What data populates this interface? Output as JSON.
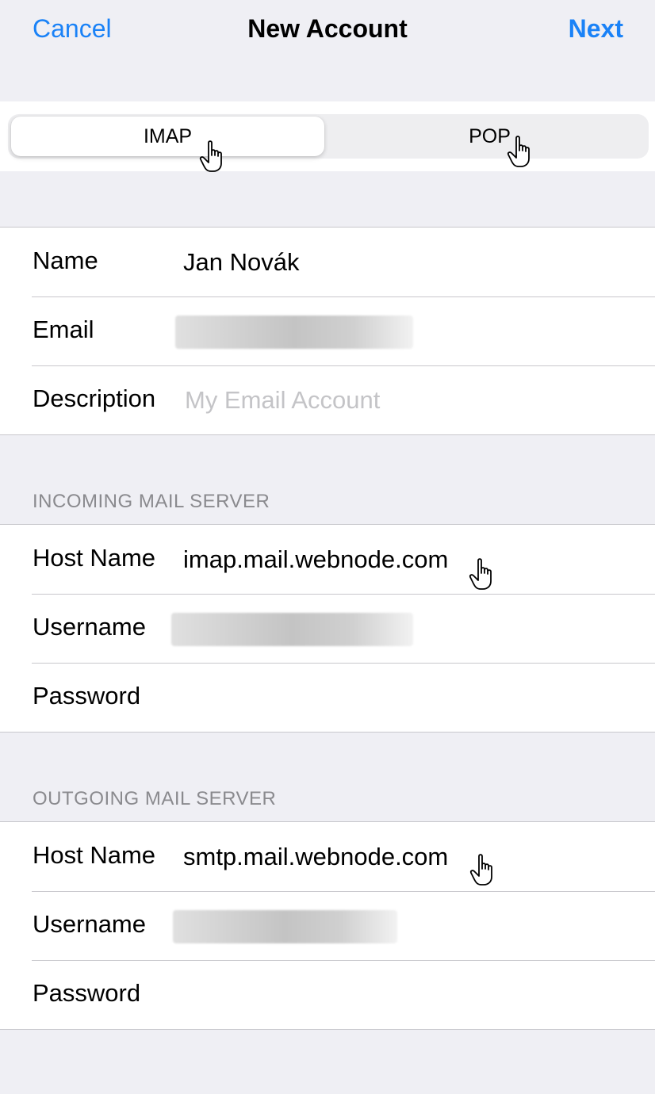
{
  "navbar": {
    "cancel_label": "Cancel",
    "title": "New Account",
    "next_label": "Next"
  },
  "segmented": {
    "options": [
      "IMAP",
      "POP"
    ],
    "selected": "IMAP"
  },
  "account": {
    "name_label": "Name",
    "name_value": "Jan Novák",
    "email_label": "Email",
    "description_label": "Description",
    "description_placeholder": "My Email Account"
  },
  "incoming": {
    "header": "INCOMING MAIL SERVER",
    "host_label": "Host Name",
    "host_value": "imap.mail.webnode.com",
    "username_label": "Username",
    "password_label": "Password"
  },
  "outgoing": {
    "header": "OUTGOING MAIL SERVER",
    "host_label": "Host Name",
    "host_value": "smtp.mail.webnode.com",
    "username_label": "Username",
    "password_label": "Password"
  },
  "colors": {
    "accent": "#1a82f7",
    "background": "#efeff4",
    "separator": "#c8c7cc",
    "section_text": "#8a8a8e",
    "placeholder": "#c4c4c7"
  },
  "icons": [
    "hand-pointer-icon"
  ]
}
